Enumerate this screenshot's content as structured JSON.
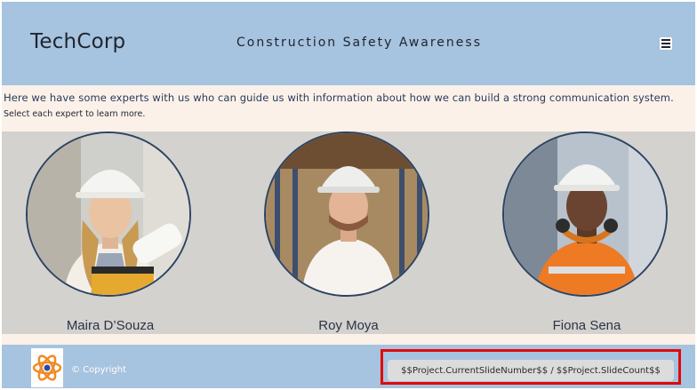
{
  "header": {
    "brand": "TechCorp",
    "course_title": "Construction Safety Awareness",
    "menu_icon": "hamburger-menu-icon"
  },
  "intro": {
    "line1": "Here we have some experts with us who can guide us with information about how we can build a strong communication system.",
    "line2": "Select each expert to learn more."
  },
  "experts": [
    {
      "name": "Maira D’Souza"
    },
    {
      "name": "Roy Moya"
    },
    {
      "name": "Fiona Sena"
    }
  ],
  "footer": {
    "logo_icon": "atom-logo-icon",
    "copyright": "© Copyright",
    "slide_counter": "$$Project.CurrentSlideNumber$$ / $$Project.SlideCount$$"
  },
  "colors": {
    "header_bg": "#a6c3df",
    "intro_bg": "#fbf1e9",
    "content_bg": "#d3d2ce",
    "portrait_border": "#2c4363",
    "highlight": "#e10a0a"
  }
}
